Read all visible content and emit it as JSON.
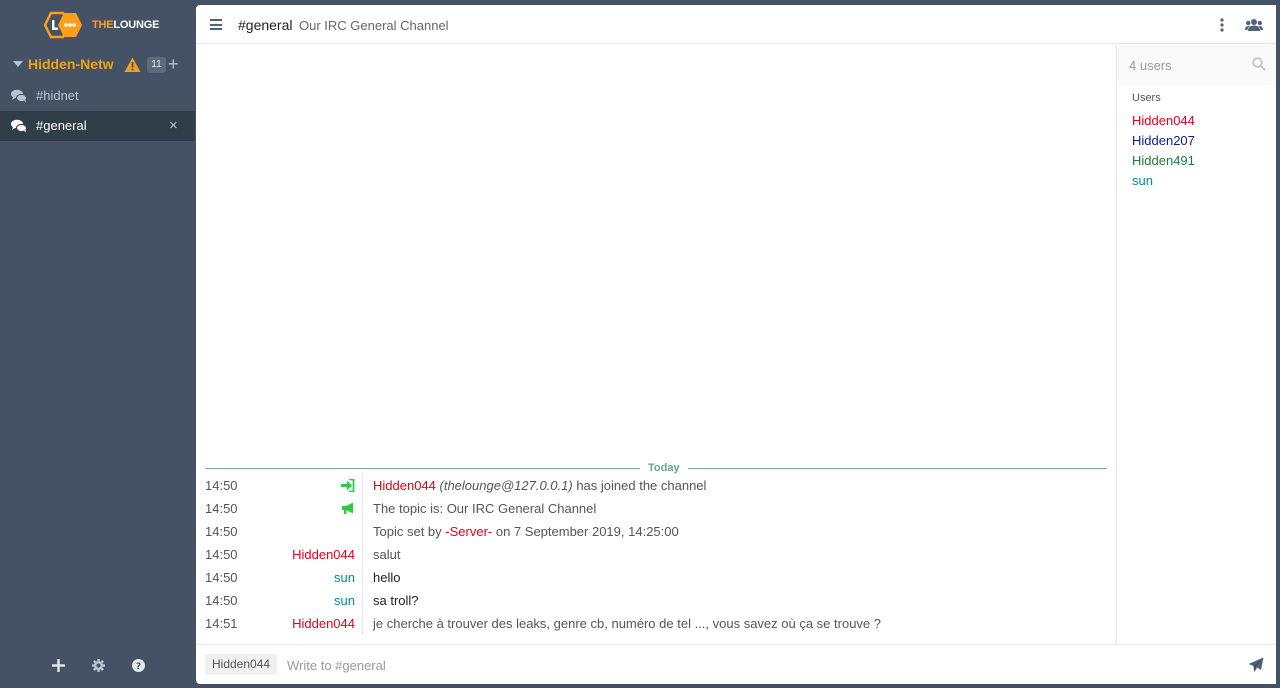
{
  "app": {
    "logo_the": "THE",
    "logo_lounge": "LOUNGE"
  },
  "sidebar": {
    "network": {
      "name": "Hidden-Netw",
      "badge": "11",
      "add": "+"
    },
    "channels": [
      {
        "label": "#hidnet",
        "active": false
      },
      {
        "label": "#general",
        "active": true,
        "close": "×"
      }
    ],
    "footer_icons": [
      "plus-icon",
      "gear-icon",
      "help-icon"
    ]
  },
  "header": {
    "channel": "#general",
    "topic": "Our IRC General Channel"
  },
  "messages": {
    "day_divider": "Today",
    "items": [
      {
        "time": "14:50",
        "from": "",
        "icon": "join-icon",
        "nick": "Hidden044",
        "host": "(thelounge@127.0.0.1)",
        "text": "has joined the channel"
      },
      {
        "time": "14:50",
        "from": "",
        "icon": "megaphone-icon",
        "text": "The topic is: Our IRC General Channel"
      },
      {
        "time": "14:50",
        "from": "",
        "pre": "Topic set by",
        "nick": "-Server-",
        "post": "on 7 September 2019, 14:25:00"
      },
      {
        "time": "14:50",
        "from": "Hidden044",
        "text": "salut"
      },
      {
        "time": "14:50",
        "from": "sun",
        "text": "hello"
      },
      {
        "time": "14:50",
        "from": "sun",
        "text": "sa troll?"
      },
      {
        "time": "14:51",
        "from": "Hidden044",
        "text": "je cherche à trouver des leaks, genre cb, numéro de tel ..., vous savez où ça se trouve ?"
      }
    ]
  },
  "userlist": {
    "count": "4 users",
    "heading": "Users",
    "users": [
      "Hidden044",
      "Hidden207",
      "Hidden491",
      "sun"
    ]
  },
  "composer": {
    "nick": "Hidden044",
    "placeholder": "Write to #general"
  },
  "colors": {
    "sidebar_bg": "#455164",
    "active_channel_bg": "#303e4a",
    "network_name": "#f0a01b",
    "nick_red": "#e2001a",
    "nick_teal": "#068c8a",
    "nick_navy": "#0f1e87",
    "nick_green": "#1e7a39",
    "join_green": "#2ecc40"
  }
}
